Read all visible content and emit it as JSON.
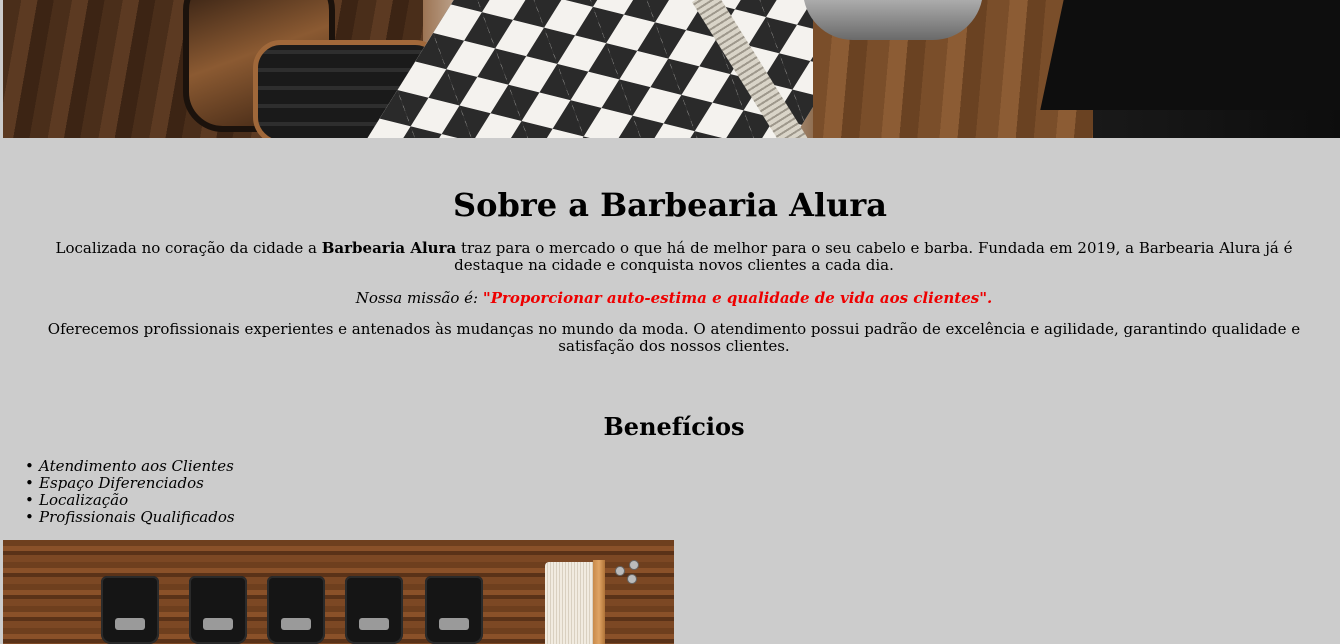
{
  "banner": {
    "alt": "barbershop interior"
  },
  "about": {
    "title": "Sobre a Barbearia Alura",
    "intro_before": "Localizada no coração da cidade a ",
    "intro_bold": "Barbearia Alura",
    "intro_after": " traz para o mercado o que há de melhor para o seu cabelo e barba. Fundada em 2019, a Barbearia Alura já é destaque na cidade e conquista novos clientes a cada dia.",
    "mission_label": "Nossa missão é: ",
    "mission_quote": "\"Proporcionar auto-estima e qualidade de vida aos clientes\".",
    "offer": "Oferecemos profissionais experientes e antenados às mudanças no mundo da moda. O atendimento possui padrão de excelência e agilidade, garantindo qualidade e satisfação dos nossos clientes."
  },
  "benefits": {
    "title": "Benefícios",
    "items": [
      "Atendimento aos Clientes",
      "Espaço Diferenciados",
      "Localização",
      "Profissionais Qualificados"
    ]
  },
  "tools_image": {
    "alt": "clipper guards and brush"
  },
  "colors": {
    "background": "#cccccc",
    "mission_highlight": "#ee0000"
  }
}
